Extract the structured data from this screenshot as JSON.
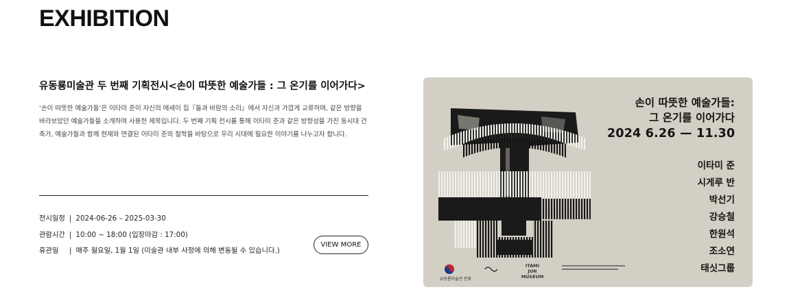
{
  "section": {
    "title": "EXHIBITION"
  },
  "exhibition": {
    "title": "유동룡미술관 두 번째 기획전시<손이 따뜻한 예술가들 : 그 온기를 이어가다>",
    "description": "‘손이 따뜻한 예술가들’은 이타미 준이 자신의 에세이 집『돌과 바람의 소리』에서 자신과 가깝게 교류하며, 같은 방향을 바라보았던 예술가들을 소개하며 사용한 제목입니다. 두 번째 기획 전시를 통해 이타미 준과 같은 방향성을 가진 동시대 건축가, 예술가들과 함께 현재와 연결된 이타미 준의 철학을 바탕으로 우리 시대에 필요한 이야기를 나누고자 합니다.",
    "info": {
      "period_label": "전시일정",
      "period_value": "2024-06-26 – 2025-03-30",
      "hours_label": "관람시간",
      "hours_value": "10:00 ~ 18:00 (입장마감 : 17:00)",
      "closed_label": "휴관일",
      "closed_value": "매주 월요일, 1월 1일 (미술관 내부 사정에 의해 변동될 수 있습니다.)"
    },
    "view_more_label": "VIEW MORE"
  },
  "poster": {
    "title_line1": "손이 따뜻한 예술가들:",
    "title_line2": "그 온기를 이어가다",
    "dates": "2024 6.26 — 11.30",
    "artists": [
      "이타미 준",
      "시게루 반",
      "박선기",
      "강승철",
      "한원석",
      "조소연",
      "태싯그룹"
    ],
    "logo1": "유동룡미술관 문화",
    "logo2": "ITAMI JUN MUSEUM"
  },
  "colors": {
    "poster_bg": "#d3cfc4",
    "ink": "#141414"
  }
}
